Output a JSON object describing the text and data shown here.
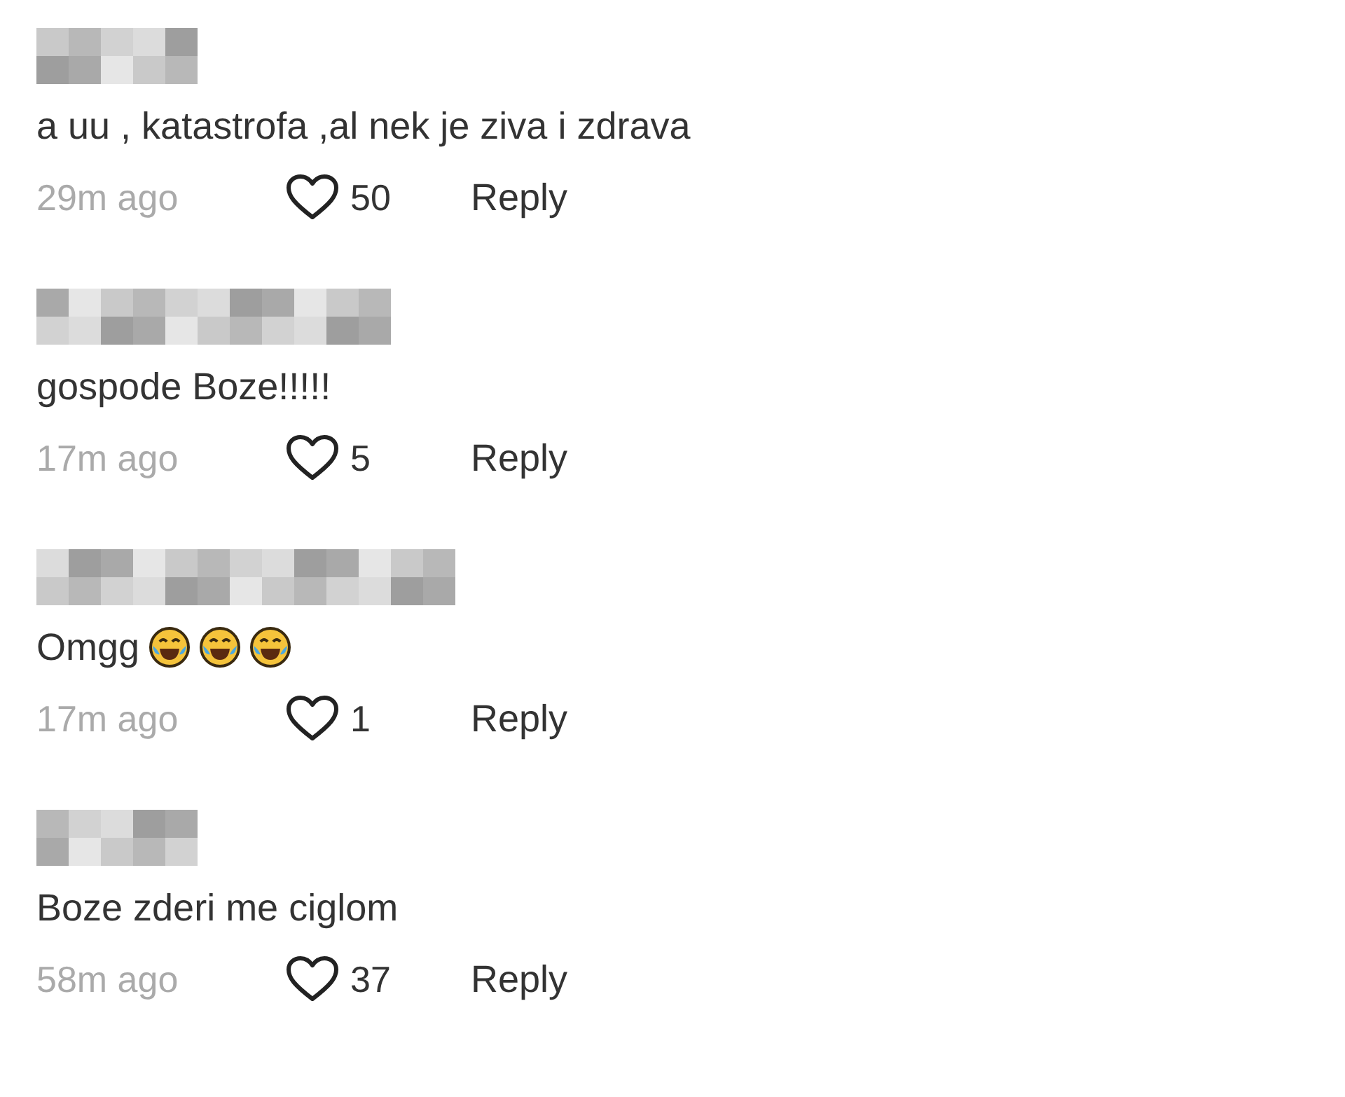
{
  "comments": [
    {
      "text": "a uu , katastrofa ,al nek je ziva i zdrava",
      "time": "29m ago",
      "likes": "50",
      "reply": "Reply"
    },
    {
      "text": "gospode Boze!!!!!",
      "time": "17m ago",
      "likes": "5",
      "reply": "Reply"
    },
    {
      "text": "Omgg",
      "emojis": [
        {
          "kind": "laughing"
        },
        {
          "kind": "laughing"
        },
        {
          "kind": "laughing"
        }
      ],
      "time": "17m ago",
      "likes": "1",
      "reply": "Reply"
    },
    {
      "text": "Boze zderi me ciglom",
      "time": "58m ago",
      "likes": "37",
      "reply": "Reply"
    }
  ]
}
